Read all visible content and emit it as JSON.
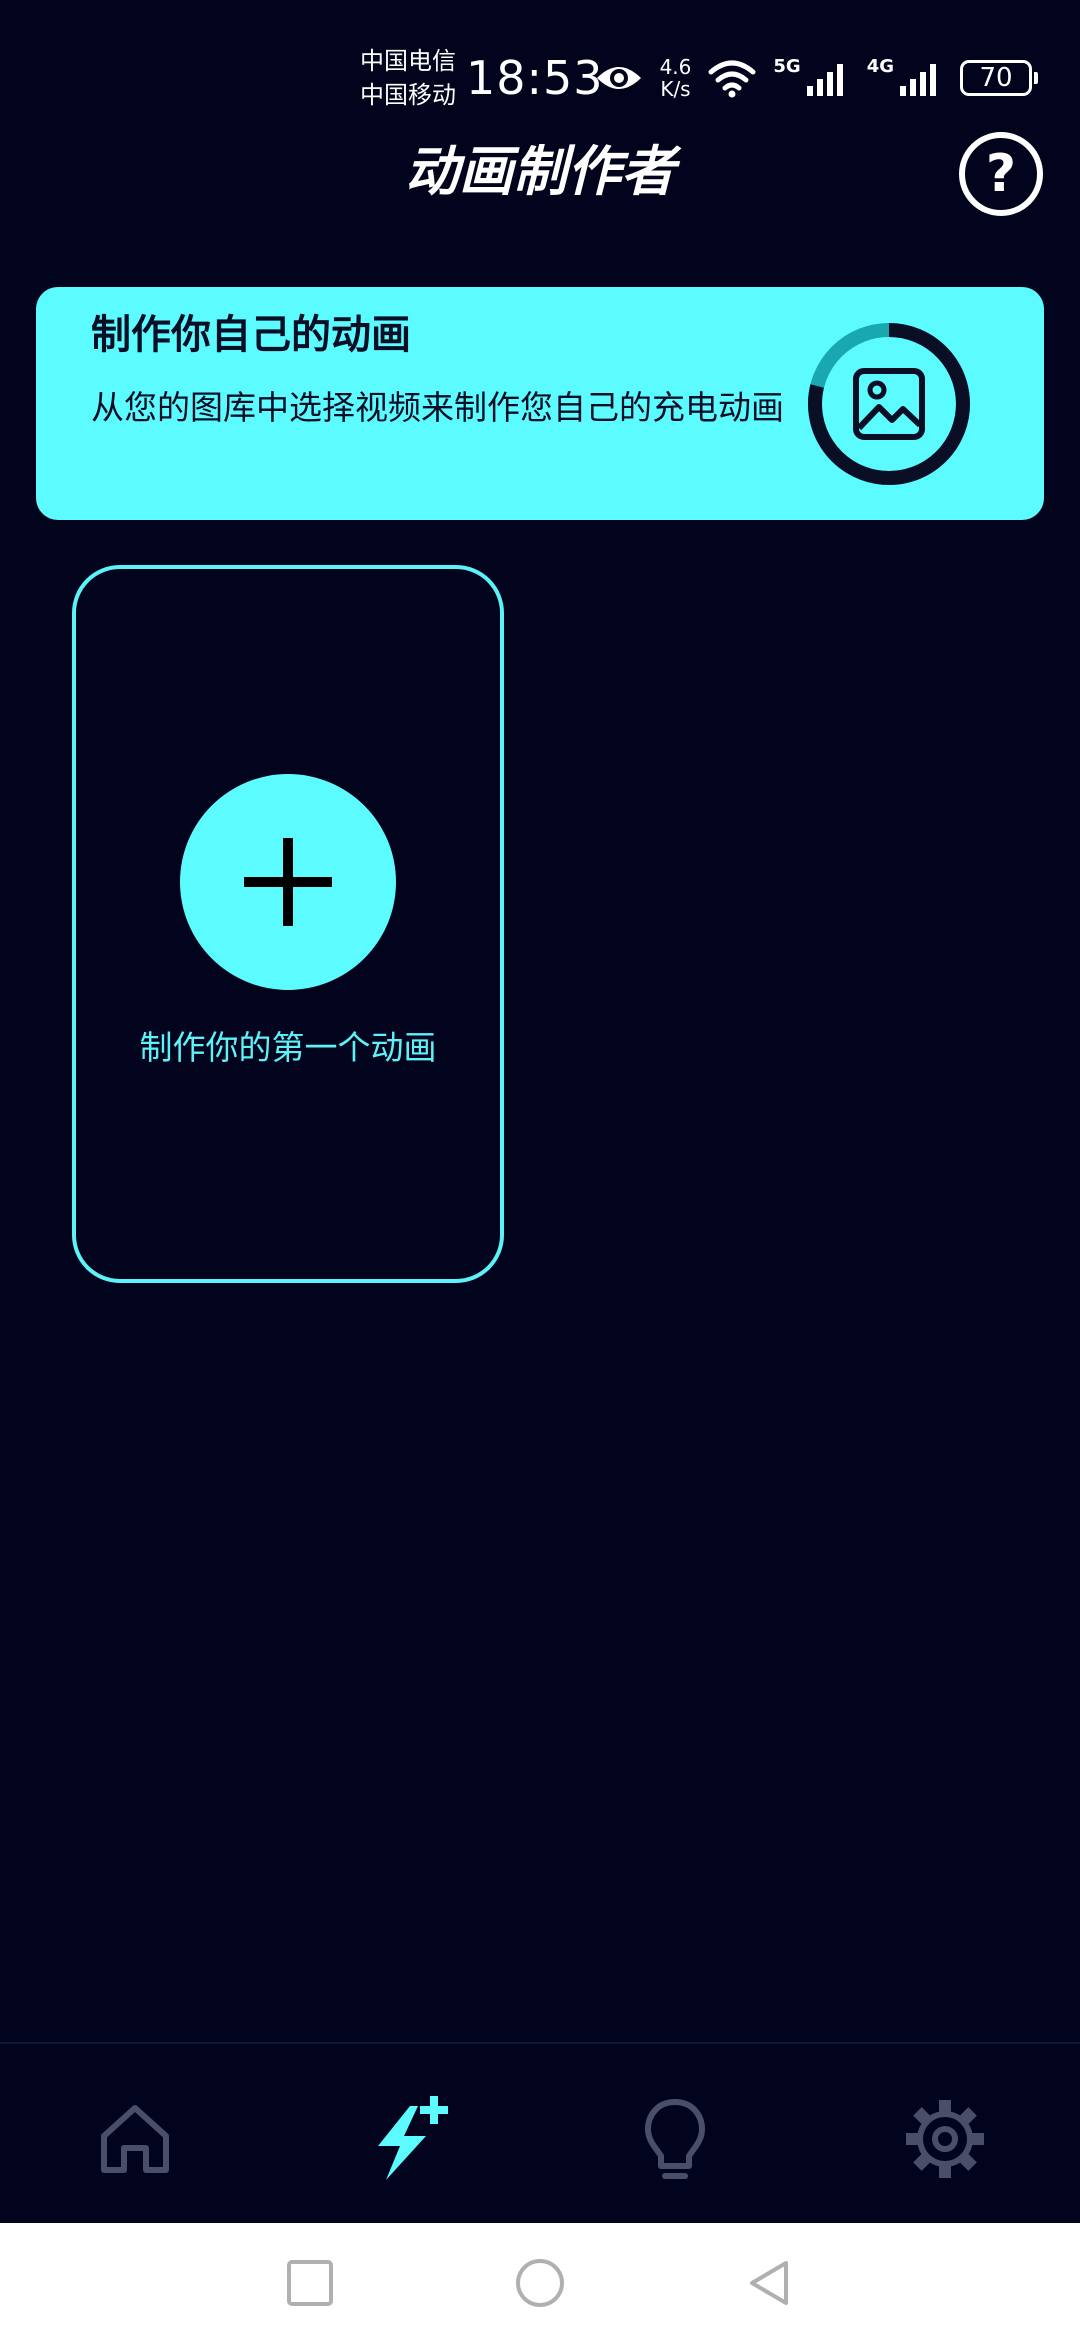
{
  "status_bar": {
    "carrier_1": "中国电信",
    "carrier_2": "中国移动",
    "time": "18:53",
    "speed_value": "4.6",
    "speed_unit": "K/s",
    "net_1": "5G",
    "net_2": "4G",
    "battery": "70",
    "icons": [
      "eye-icon",
      "wifi-icon",
      "signal-5g-icon",
      "signal-4g-icon",
      "battery-icon"
    ]
  },
  "header": {
    "title": "动画制作者",
    "help_label": "?"
  },
  "banner": {
    "title": "制作你自己的动画",
    "description": "从您的图库中选择视频来制作您自己的充电动画",
    "icon": "image-icon"
  },
  "create_card": {
    "label": "制作你的第一个动画",
    "icon": "plus-icon"
  },
  "bottom_nav": {
    "items": [
      {
        "name": "home",
        "icon": "home-icon",
        "active": false
      },
      {
        "name": "create",
        "icon": "lightning-plus-icon",
        "active": true
      },
      {
        "name": "tips",
        "icon": "lightbulb-icon",
        "active": false
      },
      {
        "name": "settings",
        "icon": "gear-icon",
        "active": false
      }
    ]
  },
  "colors": {
    "background": "#02041d",
    "accent": "#5cfbff",
    "inactive_icon": "#4a4e68",
    "text_dark": "#0a0f26"
  }
}
